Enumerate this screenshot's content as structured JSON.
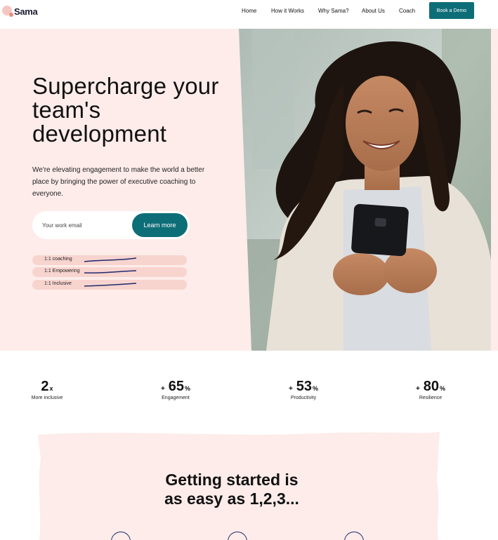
{
  "brand": {
    "name": "Sama"
  },
  "nav": {
    "links": [
      "Home",
      "How it Works",
      "Why Sama?",
      "About Us",
      "Coach"
    ],
    "cta_label": "Book a Demo"
  },
  "hero": {
    "title": "Supercharge your team's development",
    "subtitle": "We're elevating engagement to make the world a better place by bringing the power of executive coaching to everyone.",
    "email_placeholder": "Your work email",
    "learn_more_label": "Learn more",
    "features": [
      "1:1 coaching",
      "1:1 Empowering",
      "1:1 Inclusive"
    ]
  },
  "stats": [
    {
      "prefix": "",
      "value": "2",
      "unit": "x",
      "label": "More inclusive"
    },
    {
      "prefix": "+",
      "value": "65",
      "unit": "%",
      "label": "Engagement"
    },
    {
      "prefix": "+",
      "value": "53",
      "unit": "%",
      "label": "Productivity"
    },
    {
      "prefix": "+",
      "value": "80",
      "unit": "%",
      "label": "Resilience"
    }
  ],
  "getting_started": {
    "title_line1": "Getting started is",
    "title_line2": "as easy as 1,2,3..."
  },
  "colors": {
    "accent": "#0e6e78",
    "hero_bg": "#fdecea",
    "pill_bg": "#f8d4cf",
    "navy": "#1f2a6b"
  },
  "icons": [
    "logo-mark-icon",
    "squiggle-line-icon",
    "step-circle-icon"
  ]
}
